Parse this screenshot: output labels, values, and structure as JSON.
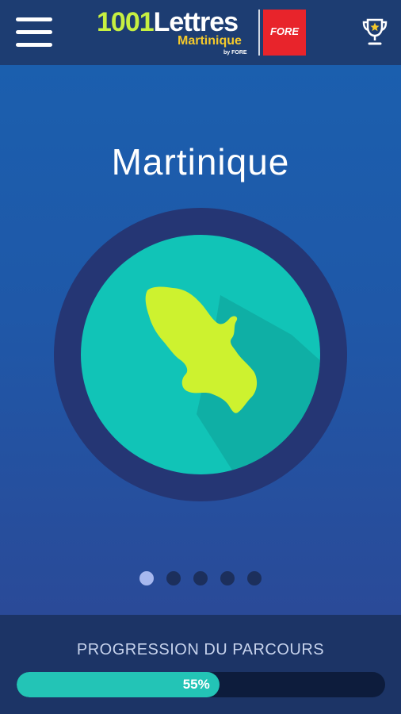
{
  "header": {
    "menu_icon": "hamburger-menu-icon",
    "logo": {
      "number": "1001",
      "word": "Lettres",
      "subtitle": "Martinique",
      "byline": "by FORE",
      "partner_logo_text": "FORE"
    },
    "trophy_icon": "trophy-star-icon"
  },
  "carousel": {
    "title": "Martinique",
    "illustration": "martinique-island-map-icon",
    "page_count": 5,
    "active_index": 0
  },
  "progress": {
    "label": "PROGRESSION DU PARCOURS",
    "value_text": "55%",
    "fraction": 0.55
  },
  "colors": {
    "header_bg": "#1d3d72",
    "hero_bg": "#1f58a8",
    "circle_ring": "#253674",
    "circle_fill": "#11c4b7",
    "island_fill": "#cdf22f",
    "progress_fill": "#23c4b6",
    "progress_track": "#0d1c3c",
    "logo_accent": "#c7f041",
    "logo_subtitle": "#f4c92b",
    "partner_red": "#e8242b"
  }
}
